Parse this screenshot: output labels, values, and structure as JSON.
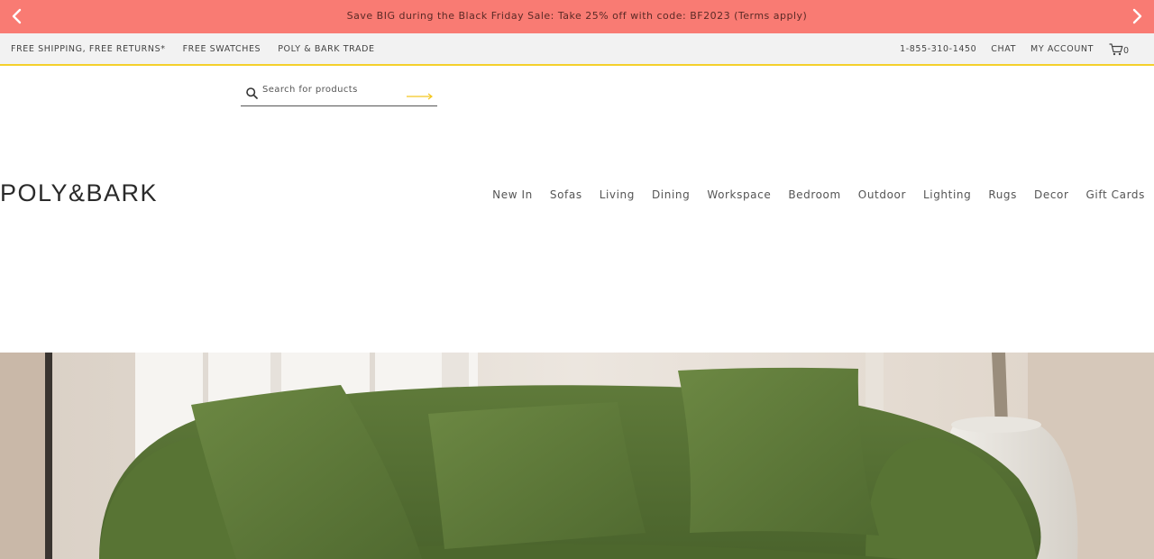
{
  "promo": {
    "text": "Save BIG during the Black Friday Sale: Take 25% off with code: BF2023 (Terms apply)",
    "prev_icon": "chevron-left-icon",
    "next_icon": "chevron-right-icon",
    "bg_color": "#f97b73"
  },
  "utility": {
    "left_links": [
      "FREE SHIPPING, FREE RETURNS*",
      "FREE SWATCHES",
      "POLY & BARK TRADE"
    ],
    "phone": "1-855-310-1450",
    "chat": "CHAT",
    "account": "MY ACCOUNT",
    "cart_count": "0",
    "accent_color": "#f4d02b"
  },
  "search": {
    "placeholder": "Search for products",
    "icon": "search-icon",
    "submit_icon": "arrow-right-icon"
  },
  "brand": {
    "logo": "POLY&BARK"
  },
  "nav": {
    "items": [
      "New In",
      "Sofas",
      "Living",
      "Dining",
      "Workspace",
      "Bedroom",
      "Outdoor",
      "Lighting",
      "Rugs",
      "Decor",
      "Gift Cards"
    ]
  },
  "hero": {
    "image": "green-curved-sofa-photo"
  }
}
